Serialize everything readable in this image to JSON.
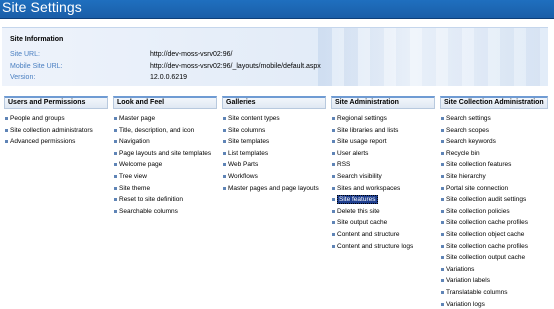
{
  "page": {
    "title": "Site Settings"
  },
  "site_info": {
    "heading": "Site Information",
    "rows": [
      {
        "label": "Site URL:",
        "value": "http://dev-moss-vsrv02:96/"
      },
      {
        "label": "Mobile Site URL:",
        "value": "http://dev-moss-vsrv02:96/_layouts/mobile/default.aspx"
      },
      {
        "label": "Version:",
        "value": "12.0.0.6219"
      }
    ]
  },
  "sections": [
    {
      "title": "Users and Permissions",
      "links": [
        "People and groups",
        "Site collection administrators",
        "Advanced permissions"
      ]
    },
    {
      "title": "Look and Feel",
      "links": [
        "Master page",
        "Title, description, and icon",
        "Navigation",
        "Page layouts and site templates",
        "Welcome page",
        "Tree view",
        "Site theme",
        "Reset to site definition",
        "Searchable columns"
      ]
    },
    {
      "title": "Galleries",
      "links": [
        "Site content types",
        "Site columns",
        "Site templates",
        "List templates",
        "Web Parts",
        "Workflows",
        "Master pages and page layouts"
      ]
    },
    {
      "title": "Site Administration",
      "selected_index": 7,
      "links": [
        "Regional settings",
        "Site libraries and lists",
        "Site usage report",
        "User alerts",
        "RSS",
        "Search visibility",
        "Sites and workspaces",
        "Site features",
        "Delete this site",
        "Site output cache",
        "Content and structure",
        "Content and structure logs"
      ]
    },
    {
      "title": "Site Collection Administration",
      "links": [
        "Search settings",
        "Search scopes",
        "Search keywords",
        "Recycle bin",
        "Site collection features",
        "Site hierarchy",
        "Portal site connection",
        "Site collection audit settings",
        "Site collection policies",
        "Site collection cache profiles",
        "Site collection object cache",
        "Site collection cache profiles",
        "Site collection output cache",
        "Variations",
        "Variation labels",
        "Translatable columns",
        "Variation logs"
      ]
    }
  ]
}
